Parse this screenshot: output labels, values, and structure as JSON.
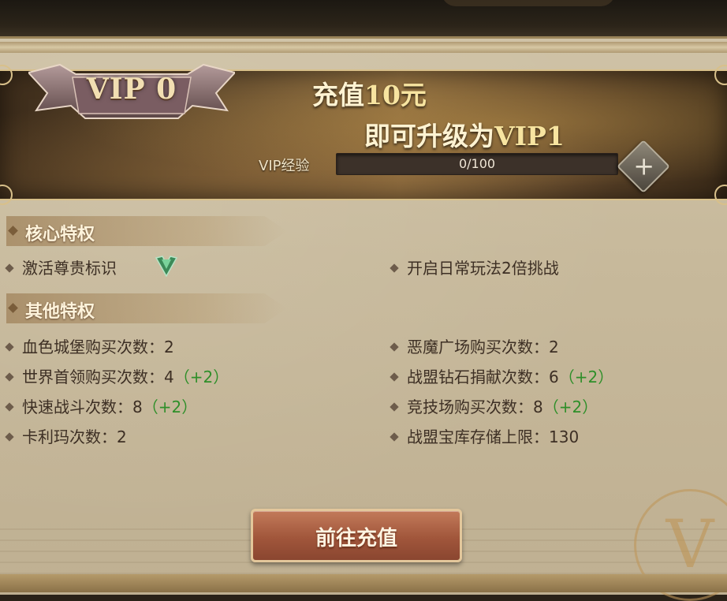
{
  "vip": {
    "badge": "VIP 0",
    "promo_prefix": "充值",
    "promo_amount": "10元",
    "promo_upgrade": "即可升级为",
    "promo_level": "VIP1",
    "exp_label": "VIP经验",
    "exp_text": "0/100",
    "exp_progress": 0,
    "plus": "+"
  },
  "sections": {
    "core_title": "核心特权",
    "other_title": "其他特权"
  },
  "core_items": [
    {
      "text": "激活尊贵标识"
    },
    {
      "text": "开启日常玩法2倍挑战"
    }
  ],
  "other_items": [
    {
      "text": "血色城堡购买次数：2",
      "bonus": ""
    },
    {
      "text": "恶魔广场购买次数：2",
      "bonus": ""
    },
    {
      "text": "世界首领购买次数：4",
      "bonus": "（+2）"
    },
    {
      "text": "战盟钻石捐献次数：6",
      "bonus": "（+2）"
    },
    {
      "text": "快速战斗次数：8",
      "bonus": "（+2）"
    },
    {
      "text": "竞技场购买次数：8",
      "bonus": "（+2）"
    },
    {
      "text": "卡利玛次数：2",
      "bonus": ""
    },
    {
      "text": "战盟宝库存储上限：130",
      "bonus": ""
    }
  ],
  "button": {
    "recharge_label": "前往充值"
  },
  "emblem": {
    "letter": "V"
  },
  "colors": {
    "bonus_green": "#2f8f2a",
    "button_red": "#a1563b",
    "gold": "#f7e4a0"
  }
}
